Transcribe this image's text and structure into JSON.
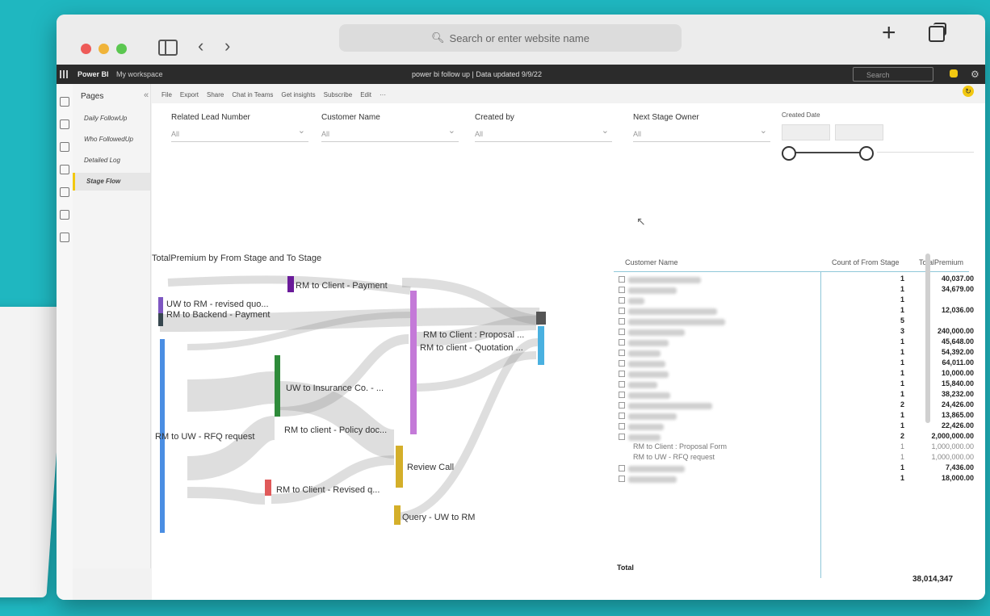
{
  "browser": {
    "search_placeholder": "Search or enter website name"
  },
  "powerbi": {
    "app_name": "Power BI",
    "workspace": "My workspace",
    "center_title": "power bi follow up  |  Data updated 9/9/22",
    "search_placeholder": "Search"
  },
  "pages": {
    "title": "Pages",
    "items": [
      "Daily FollowUp",
      "Who FollowedUp",
      "Detailed Log",
      "Stage Flow"
    ],
    "active": "Stage Flow"
  },
  "toolbar": [
    "File",
    "Export",
    "Share",
    "Chat in Teams",
    "Get insights",
    "Subscribe",
    "Edit",
    "···"
  ],
  "slicers": [
    {
      "label": "Related Lead Number",
      "value": "All"
    },
    {
      "label": "Customer Name",
      "value": "All"
    },
    {
      "label": "Created by",
      "value": "All"
    },
    {
      "label": "Next Stage Owner",
      "value": "All"
    }
  ],
  "date_slicer": {
    "label": "Created Date"
  },
  "chart": {
    "title": "TotalPremium by From Stage and To Stage",
    "nodes": [
      "RM to Client - Payment",
      "UW to RM - revised quo...",
      "RM to Backend - Payment",
      "RM to UW - RFQ request",
      "UW to Insurance Co. - ...",
      "RM to client - Policy doc...",
      "RM to Client - Revised q...",
      "RM to Client : Proposal ...",
      "RM to client - Quotation ...",
      "Review Call",
      "Query - UW to RM"
    ]
  },
  "table": {
    "headers": [
      "Customer Name",
      "Count of From Stage",
      "TotalPremium"
    ],
    "rows": [
      {
        "count": "1",
        "premium": "40,037.00"
      },
      {
        "count": "1",
        "premium": "34,679.00"
      },
      {
        "count": "1",
        "premium": ""
      },
      {
        "count": "1",
        "premium": "12,036.00"
      },
      {
        "count": "5",
        "premium": ""
      },
      {
        "count": "3",
        "premium": "240,000.00"
      },
      {
        "count": "1",
        "premium": "45,648.00"
      },
      {
        "count": "1",
        "premium": "54,392.00"
      },
      {
        "count": "1",
        "premium": "64,011.00"
      },
      {
        "count": "1",
        "premium": "10,000.00"
      },
      {
        "count": "1",
        "premium": "15,840.00"
      },
      {
        "count": "1",
        "premium": "38,232.00"
      },
      {
        "count": "2",
        "premium": "24,426.00"
      },
      {
        "count": "1",
        "premium": "13,865.00"
      },
      {
        "count": "1",
        "premium": "22,426.00"
      },
      {
        "count": "2",
        "premium": "2,000,000.00"
      },
      {
        "name": "RM to Client : Proposal Form",
        "count": "1",
        "premium": "1,000,000.00",
        "sub": true
      },
      {
        "name": "RM to UW - RFQ request",
        "count": "1",
        "premium": "1,000,000.00",
        "sub": true
      },
      {
        "count": "1",
        "premium": "7,436.00"
      },
      {
        "count": "1",
        "premium": "18,000.00"
      }
    ],
    "total_label": "Total",
    "total_value": "38,014,347"
  }
}
